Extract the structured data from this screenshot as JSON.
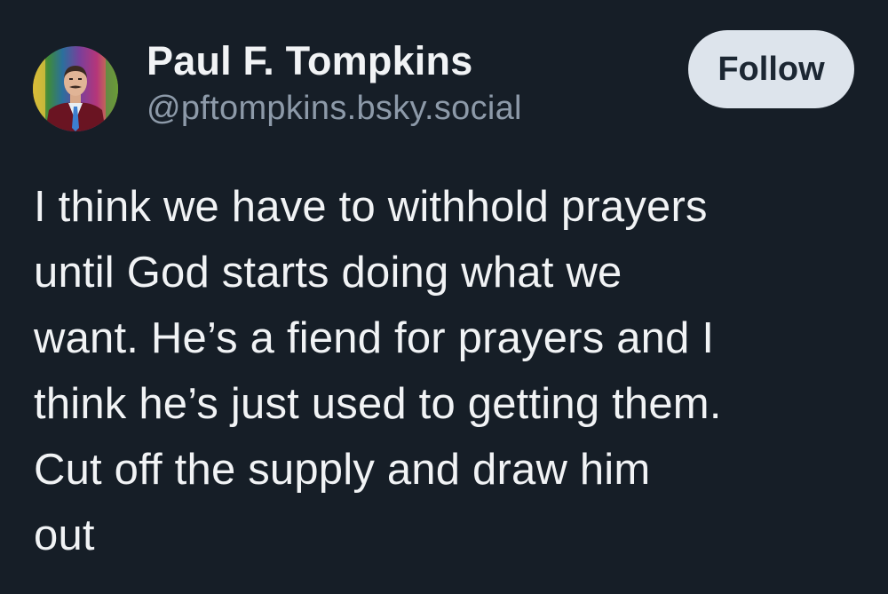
{
  "post": {
    "author": {
      "display_name": "Paul F. Tompkins",
      "handle": "@pftompkins.bsky.social"
    },
    "follow_label": "Follow",
    "text": "I think we have to withhold prayers\nuntil God starts doing what we\nwant. He’s a fiend for prayers and I\nthink he’s just used to getting them.\nCut off the supply and draw him\nout"
  },
  "colors": {
    "background": "#161e27",
    "text_primary": "#f1f3f5",
    "text_secondary": "#8d9aa9",
    "follow_button_bg": "#dde4ec",
    "follow_button_text": "#1c2733"
  }
}
